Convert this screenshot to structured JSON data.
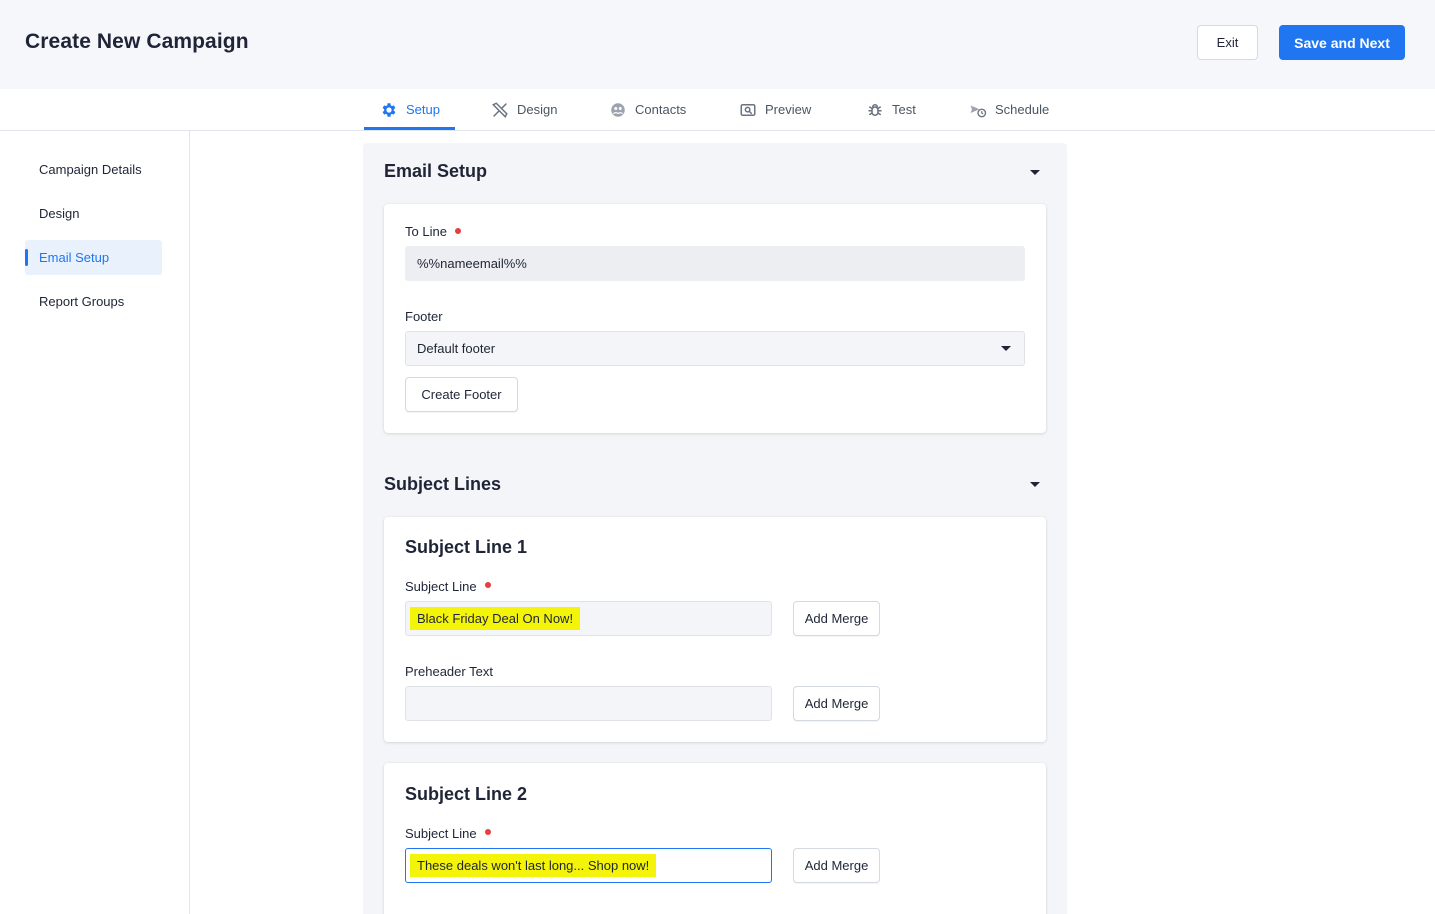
{
  "header": {
    "title": "Create New Campaign",
    "exit_label": "Exit",
    "save_label": "Save and Next"
  },
  "tabs": [
    {
      "label": "Setup",
      "icon": "gear-icon",
      "active": true
    },
    {
      "label": "Design",
      "icon": "design-tools-icon",
      "active": false
    },
    {
      "label": "Contacts",
      "icon": "contacts-icon",
      "active": false
    },
    {
      "label": "Preview",
      "icon": "preview-icon",
      "active": false
    },
    {
      "label": "Test",
      "icon": "bug-icon",
      "active": false
    },
    {
      "label": "Schedule",
      "icon": "schedule-icon",
      "active": false
    }
  ],
  "sidebar": {
    "items": [
      {
        "label": "Campaign Details",
        "active": false
      },
      {
        "label": "Design",
        "active": false
      },
      {
        "label": "Email Setup",
        "active": true
      },
      {
        "label": "Report Groups",
        "active": false
      }
    ]
  },
  "email_setup": {
    "title": "Email Setup",
    "to_line_label": "To Line",
    "to_line_value": "%%nameemail%%",
    "footer_label": "Footer",
    "footer_selected": "Default footer",
    "create_footer_label": "Create Footer"
  },
  "subject_lines": {
    "title": "Subject Lines",
    "items": [
      {
        "title": "Subject Line 1",
        "subject_label": "Subject Line",
        "subject_value": "Black Friday Deal On Now!",
        "add_merge_label": "Add Merge",
        "preheader_label": "Preheader Text",
        "preheader_value": "",
        "preheader_add_merge_label": "Add Merge"
      },
      {
        "title": "Subject Line 2",
        "subject_label": "Subject Line",
        "subject_value": "These deals won't last long... Shop now!",
        "add_merge_label": "Add Merge"
      }
    ]
  },
  "colors": {
    "accent": "#1f76f0",
    "required": "#e53e3e",
    "highlight": "#f4f40a"
  }
}
